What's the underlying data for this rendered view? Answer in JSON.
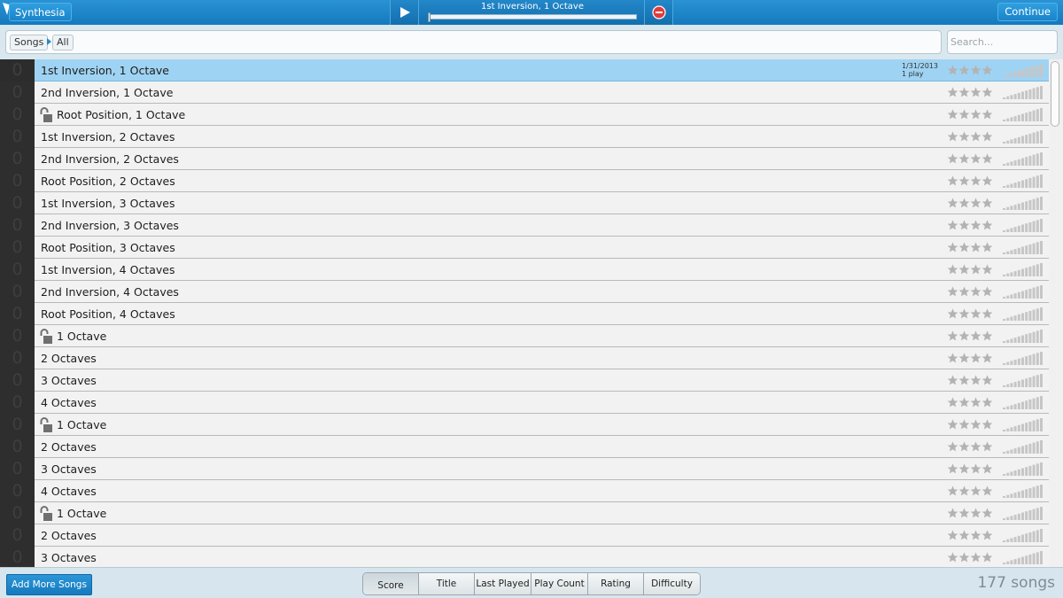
{
  "topbar": {
    "app_label": "Synthesia",
    "now_playing": "1st Inversion, 1 Octave",
    "progress": 0.0,
    "continue_label": "Continue",
    "play_icon": "play-icon",
    "stop_icon": "stop-icon"
  },
  "breadcrumb": {
    "root": "Songs",
    "current": "All"
  },
  "search": {
    "placeholder": "Search..."
  },
  "songs": [
    {
      "title": "1st Inversion, 1 Octave",
      "score": "0",
      "locked": false,
      "selected": true,
      "last_played": "1/31/2013",
      "play_count": "1 play",
      "rating": 0
    },
    {
      "title": "2nd Inversion, 1 Octave",
      "score": "0",
      "locked": false
    },
    {
      "title": "Root Position, 1 Octave",
      "score": "0",
      "locked": true
    },
    {
      "title": "1st Inversion, 2 Octaves",
      "score": "0",
      "locked": false
    },
    {
      "title": "2nd Inversion, 2 Octaves",
      "score": "0",
      "locked": false
    },
    {
      "title": "Root Position, 2 Octaves",
      "score": "0",
      "locked": false
    },
    {
      "title": "1st Inversion, 3 Octaves",
      "score": "0",
      "locked": false
    },
    {
      "title": "2nd Inversion, 3 Octaves",
      "score": "0",
      "locked": false
    },
    {
      "title": "Root Position, 3 Octaves",
      "score": "0",
      "locked": false
    },
    {
      "title": "1st Inversion, 4 Octaves",
      "score": "0",
      "locked": false
    },
    {
      "title": "2nd Inversion, 4 Octaves",
      "score": "0",
      "locked": false
    },
    {
      "title": "Root Position, 4 Octaves",
      "score": "0",
      "locked": false
    },
    {
      "title": "1 Octave",
      "score": "0",
      "locked": true
    },
    {
      "title": "2 Octaves",
      "score": "0",
      "locked": false
    },
    {
      "title": "3 Octaves",
      "score": "0",
      "locked": false
    },
    {
      "title": "4 Octaves",
      "score": "0",
      "locked": false
    },
    {
      "title": "1 Octave",
      "score": "0",
      "locked": true
    },
    {
      "title": "2 Octaves",
      "score": "0",
      "locked": false
    },
    {
      "title": "3 Octaves",
      "score": "0",
      "locked": false
    },
    {
      "title": "4 Octaves",
      "score": "0",
      "locked": false
    },
    {
      "title": "1 Octave",
      "score": "0",
      "locked": true
    },
    {
      "title": "2 Octaves",
      "score": "0",
      "locked": false
    },
    {
      "title": "3 Octaves",
      "score": "0",
      "locked": false
    }
  ],
  "bottombar": {
    "add_label": "Add More Songs",
    "sort_tabs": [
      {
        "label": "Score",
        "active": true
      },
      {
        "label": "Title",
        "active": false
      },
      {
        "label": "Last Played",
        "active": false
      },
      {
        "label": "Play Count",
        "active": false
      },
      {
        "label": "Rating",
        "active": false
      },
      {
        "label": "Difficulty",
        "active": false
      }
    ],
    "song_count": "177 songs"
  },
  "colors": {
    "accent": "#1a84c9",
    "selected_row": "#9fd3f3",
    "star_empty": "#b3b3b3",
    "bar_empty": "#c6c6c6"
  }
}
